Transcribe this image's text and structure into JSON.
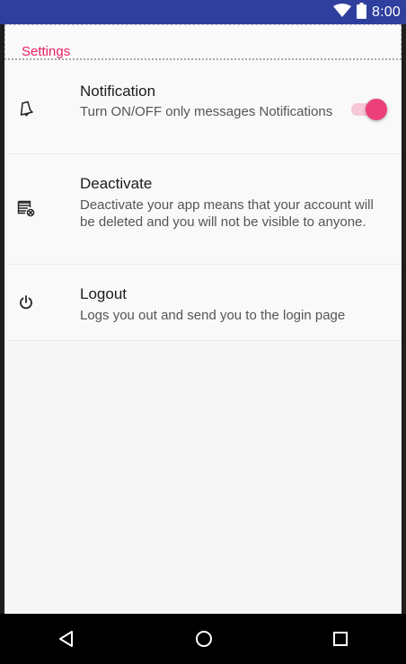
{
  "status_bar": {
    "time": "8:00",
    "icons": [
      "wifi-icon",
      "battery-icon"
    ],
    "background": "#2f3f9e"
  },
  "header": {
    "title": "Settings",
    "accent": "#e91e63"
  },
  "settings": [
    {
      "id": "notification",
      "icon": "bell-icon",
      "title": "Notification",
      "summary": "Turn ON/OFF only messages Notifications",
      "toggle": {
        "on": true,
        "color": "#ec407a"
      }
    },
    {
      "id": "deactivate",
      "icon": "list-cancel-icon",
      "title": "Deactivate",
      "summary": "Deactivate your app means that your account will be deleted and you will not be visible to anyone."
    },
    {
      "id": "logout",
      "icon": "power-icon",
      "title": "Logout",
      "summary": "Logs you out and send you to the login page"
    }
  ],
  "nav_bar": {
    "buttons": [
      "back-icon",
      "home-icon",
      "recents-icon"
    ]
  }
}
